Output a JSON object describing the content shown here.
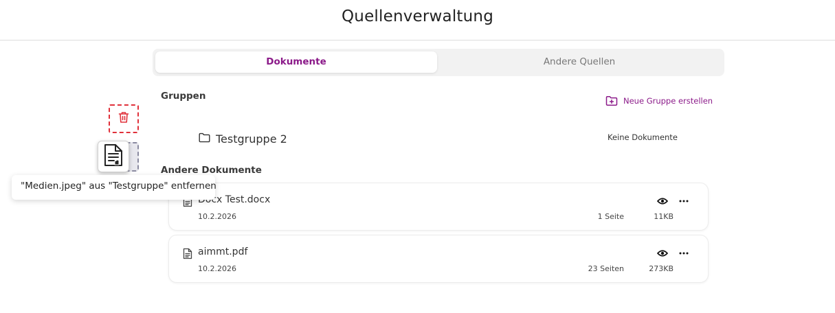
{
  "header": {
    "title": "Quellenverwaltung"
  },
  "tabs": [
    {
      "label": "Dokumente",
      "active": true
    },
    {
      "label": "Andere Quellen",
      "active": false
    }
  ],
  "groups_section": {
    "label": "Gruppen",
    "new_group_label": "Neue Gruppe erstellen",
    "groups": [
      {
        "name": "Testgruppe 2",
        "status": "Keine Dokumente"
      }
    ]
  },
  "other_docs_section": {
    "label": "Andere Dokumente",
    "documents": [
      {
        "name": "Docx Test.docx",
        "date": "10.2.2026",
        "pages": "1 Seite",
        "size": "11KB"
      },
      {
        "name": "aimmt.pdf",
        "date": "10.2.2026",
        "pages": "23 Seiten",
        "size": "273KB"
      }
    ]
  },
  "drag_overlay": {
    "tooltip": "\"Medien.jpeg\" aus \"Testgruppe\" entfernen"
  },
  "icons": {
    "new_group": "folder-plus-icon",
    "group": "folder-icon",
    "document": "file-text-icon",
    "preview": "eye-icon",
    "more": "more-horizontal-icon",
    "delete": "trash-icon",
    "drag_handle": "document-drag-icon"
  },
  "colors": {
    "accent": "#8b1a89",
    "danger": "#e0303a",
    "tab_bg": "#f2f2f2"
  }
}
